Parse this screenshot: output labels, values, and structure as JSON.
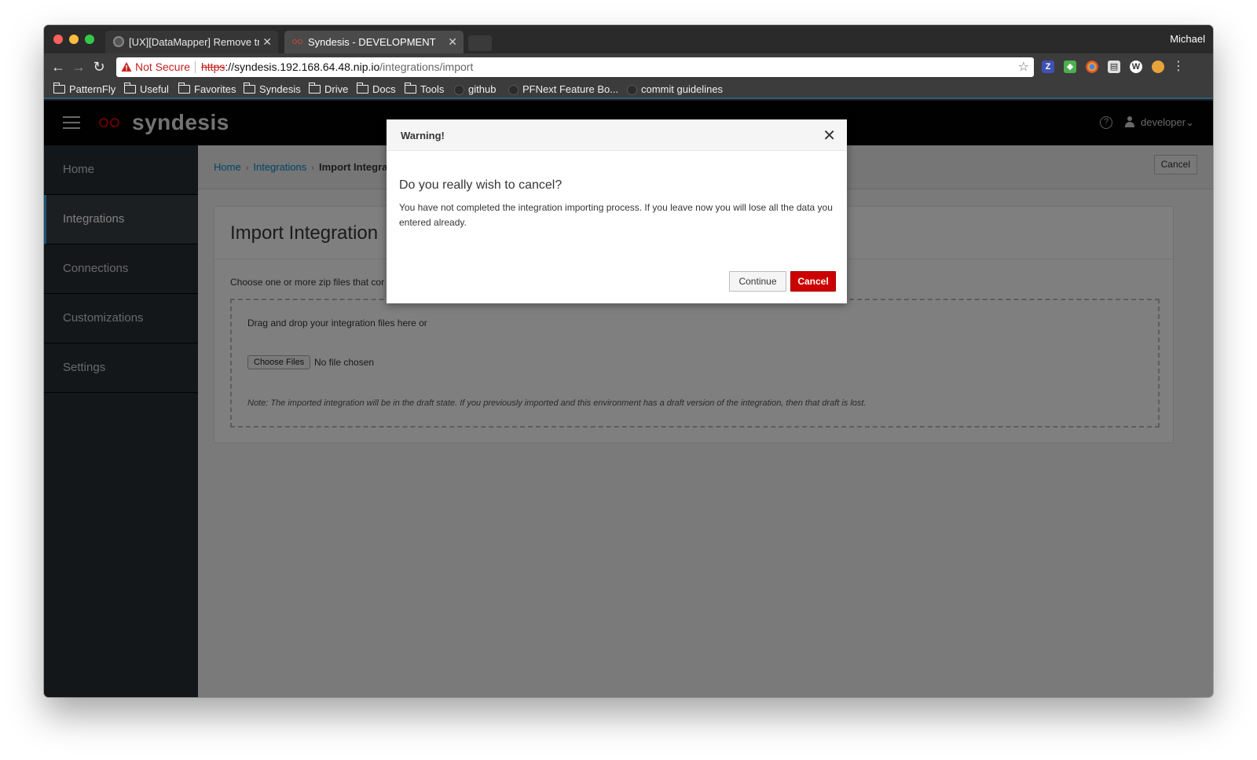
{
  "browser": {
    "profile_name": "Michael",
    "tabs": [
      {
        "title": "[UX][DataMapper] Remove tra",
        "icon": "github-icon"
      },
      {
        "title": "Syndesis - DEVELOPMENT",
        "icon": "syndesis-icon"
      }
    ],
    "address": {
      "security_label": "Not Secure",
      "scheme": "https",
      "host": "://syndesis.192.168.64.48.nip.io",
      "path": "/integrations/import"
    },
    "bookmarks": [
      {
        "label": "PatternFly",
        "icon": "folder-icon"
      },
      {
        "label": "Useful",
        "icon": "folder-icon"
      },
      {
        "label": "Favorites",
        "icon": "folder-icon"
      },
      {
        "label": "Syndesis",
        "icon": "folder-icon"
      },
      {
        "label": "Drive",
        "icon": "folder-icon"
      },
      {
        "label": "Docs",
        "icon": "folder-icon"
      },
      {
        "label": "Tools",
        "icon": "folder-icon"
      },
      {
        "label": "github",
        "icon": "github-icon"
      },
      {
        "label": "PFNext Feature Bo...",
        "icon": "github-icon"
      },
      {
        "label": "commit guidelines",
        "icon": "github-icon"
      }
    ]
  },
  "app": {
    "brand": "syndesis",
    "user": "developer",
    "sidebar": {
      "items": [
        {
          "label": "Home"
        },
        {
          "label": "Integrations"
        },
        {
          "label": "Connections"
        },
        {
          "label": "Customizations"
        },
        {
          "label": "Settings"
        }
      ],
      "active": "Integrations"
    },
    "breadcrumb": {
      "home": "Home",
      "integrations": "Integrations",
      "current": "Import Integra"
    },
    "header_cancel": "Cancel",
    "page": {
      "title": "Import Integration",
      "description": "Choose one or more zip files that cor",
      "dropzone_text": "Drag and drop your integration files here or",
      "choose_files": "Choose Files",
      "no_file": "No file chosen",
      "note": "Note: The imported integration will be in the draft state. If you previously imported and this environment has a draft version of the integration, then that draft is lost."
    }
  },
  "modal": {
    "title": "Warning!",
    "heading": "Do you really wish to cancel?",
    "body": "You have not completed the integration importing process. If you leave now you will lose all the data you entered already.",
    "continue_label": "Continue",
    "cancel_label": "Cancel"
  },
  "colors": {
    "accent": "#0088ce",
    "danger": "#cc0000",
    "sidebar": "#292e34",
    "masthead": "#030303"
  }
}
